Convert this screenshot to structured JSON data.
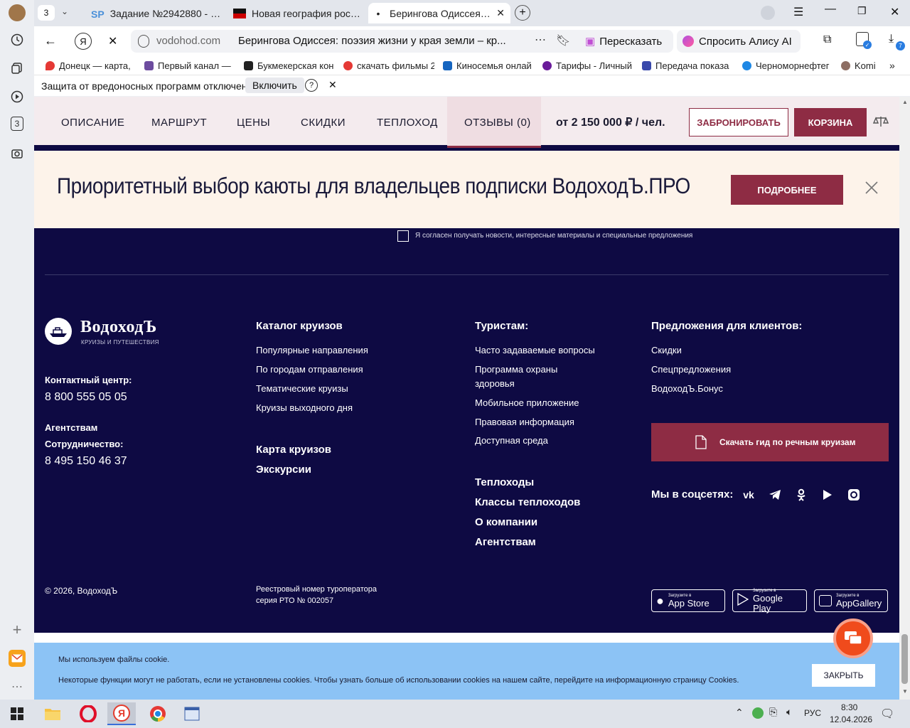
{
  "browser": {
    "tab_count": "3",
    "tabs": [
      {
        "label": "Задание №2942880 - про"
      },
      {
        "label": "Новая география роскош"
      },
      {
        "label": "Берингова Одиссея: по"
      }
    ],
    "url_domain": "vodohod.com",
    "page_title": "Берингова Одиссея: поэзия жизни у края земли – кр...",
    "retell_label": "Пересказать",
    "alice_label": "Спросить Алису AI",
    "downloads_badge": "7",
    "bookmarks": [
      {
        "label": "Донецк — карта,",
        "color": "#e53935"
      },
      {
        "label": "Первый канал —",
        "color": "#6d4c9f"
      },
      {
        "label": "Букмекерская кон",
        "color": "#222222"
      },
      {
        "label": "скачать фильмы 2",
        "color": "#e53935"
      },
      {
        "label": "Киносемья онлай",
        "color": "#1565c0"
      },
      {
        "label": "Тарифы - Личный",
        "color": "#6a1b9a"
      },
      {
        "label": "Передача показа",
        "color": "#3949ab"
      },
      {
        "label": "Черноморнефтег",
        "color": "#1e88e5"
      },
      {
        "label": "Komi",
        "color": "#8d6e63"
      }
    ],
    "warning_text": "Защита от вредоносных программ отключена",
    "warning_button": "Включить"
  },
  "site": {
    "nav": {
      "items": [
        "ОПИСАНИЕ",
        "МАРШРУТ",
        "ЦЕНЫ",
        "СКИДКИ",
        "ТЕПЛОХОД",
        "ОТЗЫВЫ (0)"
      ],
      "price": "от 2 150 000 ₽ / чел.",
      "book_button": "ЗАБРОНИРОВАТЬ",
      "cart_button": "КОРЗИНА"
    },
    "promo": {
      "text": "Приоритетный выбор каюты для владельцев подписки ВодоходЪ.ПРО",
      "button": "ПОДРОБНЕЕ"
    },
    "consent_text": "Я согласен получать новости, интересные материалы и специальные предложения",
    "logo": {
      "name": "ВодоходЪ",
      "tagline": "КРУИЗЫ И ПУТЕШЕСТВИЯ"
    },
    "contact": {
      "center_label": "Контактный центр:",
      "center_phone": "8 800 555 05 05",
      "agency_label": "Агентствам",
      "coop_label": "Сотрудничество:",
      "coop_phone": "8 495 150 46 37"
    },
    "catalog": {
      "heading": "Каталог круизов",
      "links": [
        "Популярные направления",
        "По городам отправления",
        "Тематические круизы",
        "Круизы выходного дня"
      ],
      "map": "Карта круизов",
      "excursions": "Экскурсии"
    },
    "tourists": {
      "heading": "Туристам:",
      "links": [
        "Часто задаваемые вопросы",
        "Программа охраны",
        "здоровья",
        "Мобильное приложение",
        "Правовая информация",
        "Доступная среда"
      ],
      "bold_links": [
        "Теплоходы",
        "Классы теплоходов",
        "О компании",
        "Агентствам"
      ]
    },
    "offers": {
      "heading": "Предложения для клиентов:",
      "links": [
        "Скидки",
        "Спецпредложения",
        "ВодоходЪ.Бонус"
      ],
      "guide_button": "Скачать гид по речным круизам",
      "social_label": "Мы в соцсетях:"
    },
    "copyright": "© 2026, ВодоходЪ",
    "registry_line1": "Реестровый номер туроператора",
    "registry_line2": "серия РТО № 002057",
    "stores": [
      {
        "small": "Загрузите в",
        "name": "App Store"
      },
      {
        "small": "Загрузите в",
        "name": "Google Play"
      },
      {
        "small": "Загрузите в",
        "name": "AppGallery"
      }
    ],
    "cookie": {
      "title": "Мы используем файлы cookie.",
      "text": "Некоторые функции могут не работать, если не установлены cookies. Чтобы узнать больше об использовании cookies на нашем сайте, перейдите на информационную страницу Cookies.",
      "close": "ЗАКРЫТЬ"
    }
  },
  "taskbar": {
    "lang": "РУС",
    "time": "8:30",
    "date": "12.04.2026"
  },
  "colors": {
    "footer_bg": "#0e0a43",
    "brand_red": "#8e2c44",
    "cookie_bg": "#8cc3f5",
    "chat_orange": "#f04b1c"
  }
}
